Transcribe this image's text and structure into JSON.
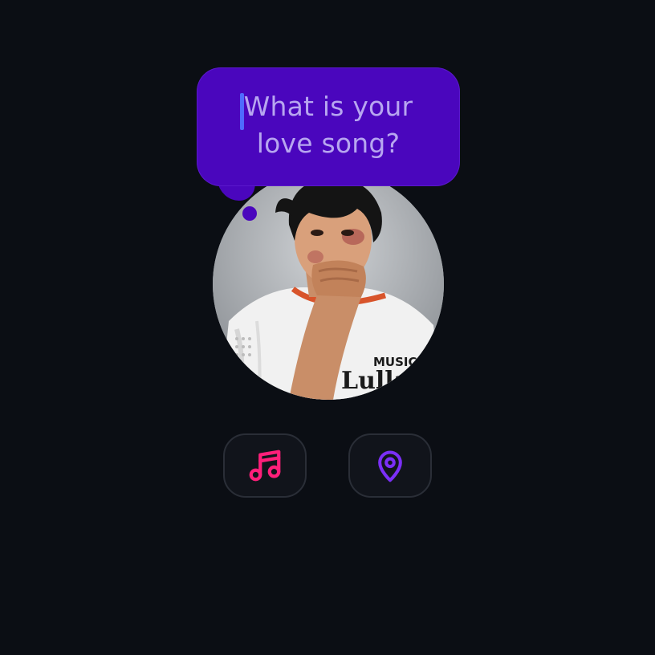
{
  "prompt": {
    "line1": "What is your",
    "line2": "love song?",
    "bubble_color": "#4a06bd",
    "text_color": "#b7a6f0",
    "caret_color": "#4f6bff"
  },
  "avatar": {
    "shirt_text_line1": "MUSIC",
    "shirt_text_line2": "Lullaby"
  },
  "actions": [
    {
      "icon": "music-note-icon",
      "color": "#ff1f7a"
    },
    {
      "icon": "location-pin-icon",
      "color": "#7b2ff7"
    }
  ],
  "background_color": "#0b0e14"
}
